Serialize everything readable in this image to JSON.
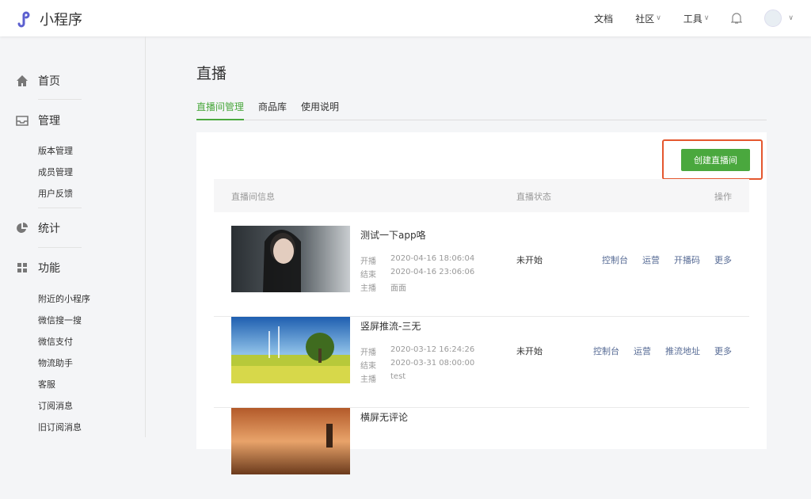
{
  "header": {
    "app_name": "小程序",
    "nav": [
      {
        "label": "文档"
      },
      {
        "label": "社区"
      },
      {
        "label": "工具"
      }
    ]
  },
  "sidebar": {
    "home": "首页",
    "manage": "管理",
    "manage_items": [
      "版本管理",
      "成员管理",
      "用户反馈"
    ],
    "stats": "统计",
    "features": "功能",
    "feature_items": [
      "附近的小程序",
      "微信搜一搜",
      "微信支付",
      "物流助手",
      "客服",
      "订阅消息",
      "旧订阅消息"
    ]
  },
  "page": {
    "title": "直播",
    "tabs": [
      "直播间管理",
      "商品库",
      "使用说明"
    ],
    "create_button": "创建直播间"
  },
  "table": {
    "headers": [
      "直播间信息",
      "直播状态",
      "操作"
    ],
    "labels": {
      "start": "开播",
      "end": "结束",
      "host": "主播"
    },
    "rows": [
      {
        "title": "测试一下app咯",
        "start": "2020-04-16 18:06:04",
        "end": "2020-04-16 23:06:06",
        "host": "面面",
        "status": "未开始",
        "actions": [
          "控制台",
          "运营",
          "开播码",
          "更多"
        ]
      },
      {
        "title": "竖屏推流-三无",
        "start": "2020-03-12 16:24:26",
        "end": "2020-03-31 08:00:00",
        "host": "test",
        "status": "未开始",
        "actions": [
          "控制台",
          "运营",
          "推流地址",
          "更多"
        ]
      },
      {
        "title": "横屏无评论",
        "start": "",
        "end": "",
        "host": "",
        "status": "",
        "actions": []
      }
    ]
  },
  "colors": {
    "accent": "#4aa83e",
    "link": "#576b95",
    "highlight": "#e4572e"
  }
}
